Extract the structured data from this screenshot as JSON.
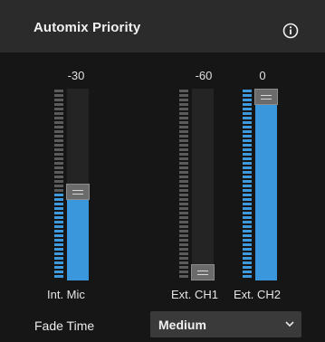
{
  "header": {
    "title": "Automix Priority",
    "info_icon": "info-circle-icon"
  },
  "channels": [
    {
      "name": "Int. Mic",
      "value": "-30",
      "level_fraction": 0.46
    },
    {
      "name": "Ext. CH1",
      "value": "-60",
      "level_fraction": 0.0
    },
    {
      "name": "Ext. CH2",
      "value": "0",
      "level_fraction": 1.0
    }
  ],
  "fade_time": {
    "label": "Fade Time",
    "selected": "Medium"
  },
  "colors": {
    "accent": "#3a97dc",
    "header": "#2b2b2b",
    "background": "#161616"
  }
}
